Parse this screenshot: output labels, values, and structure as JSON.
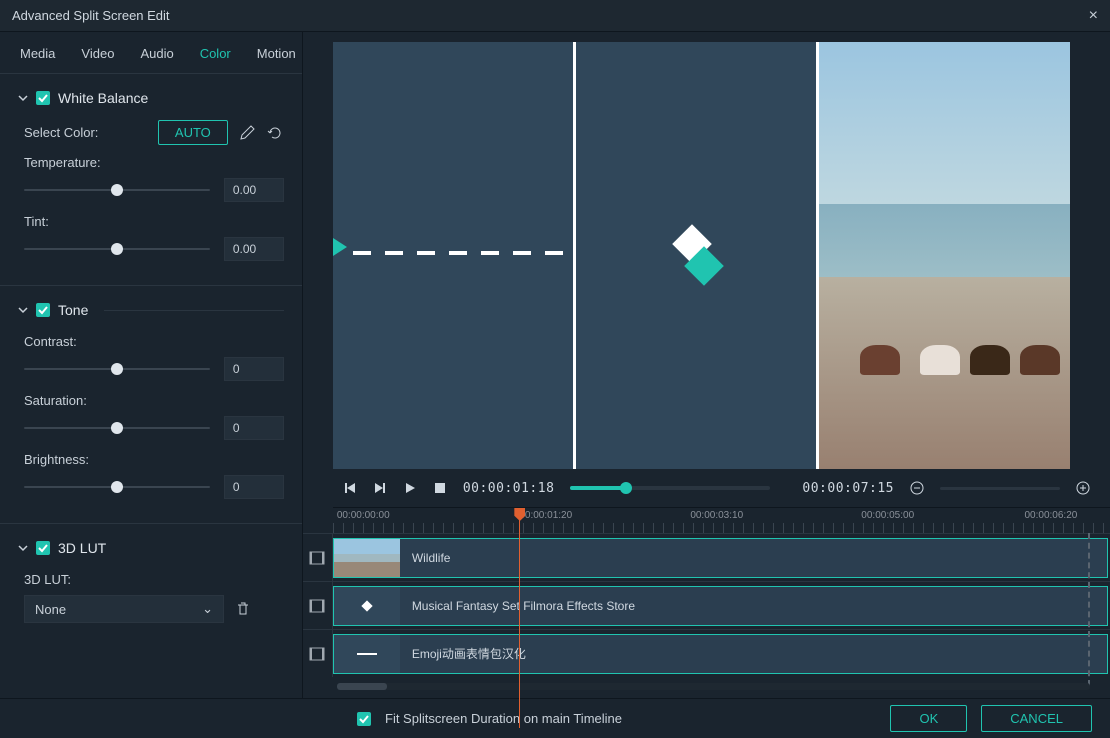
{
  "window": {
    "title": "Advanced Split Screen Edit"
  },
  "tabs": [
    "Media",
    "Video",
    "Audio",
    "Color",
    "Motion"
  ],
  "activeTab": "Color",
  "whiteBalance": {
    "title": "White Balance",
    "selectColorLabel": "Select Color:",
    "autoLabel": "AUTO",
    "temperatureLabel": "Temperature:",
    "temperatureValue": "0.00",
    "tintLabel": "Tint:",
    "tintValue": "0.00"
  },
  "tone": {
    "title": "Tone",
    "contrastLabel": "Contrast:",
    "contrastValue": "0",
    "saturationLabel": "Saturation:",
    "saturationValue": "0",
    "brightnessLabel": "Brightness:",
    "brightnessValue": "0"
  },
  "lut": {
    "title": "3D LUT",
    "label": "3D LUT:",
    "selected": "None"
  },
  "playback": {
    "current": "00:00:01:18",
    "total": "00:00:07:15"
  },
  "ruler": {
    "ticks": [
      "00:00:00:00",
      "00:00:01:20",
      "00:00:03:10",
      "00:00:05:00",
      "00:00:06:20"
    ]
  },
  "tracks": [
    {
      "name": "Wildlife",
      "thumb": "photo"
    },
    {
      "name": "Musical Fantasy Set Filmora Effects Store",
      "thumb": "logo"
    },
    {
      "name": "Emoji动画表情包汉化",
      "thumb": "emoji"
    }
  ],
  "footer": {
    "fitLabel": "Fit Splitscreen Duration on main Timeline",
    "ok": "OK",
    "cancel": "CANCEL"
  }
}
